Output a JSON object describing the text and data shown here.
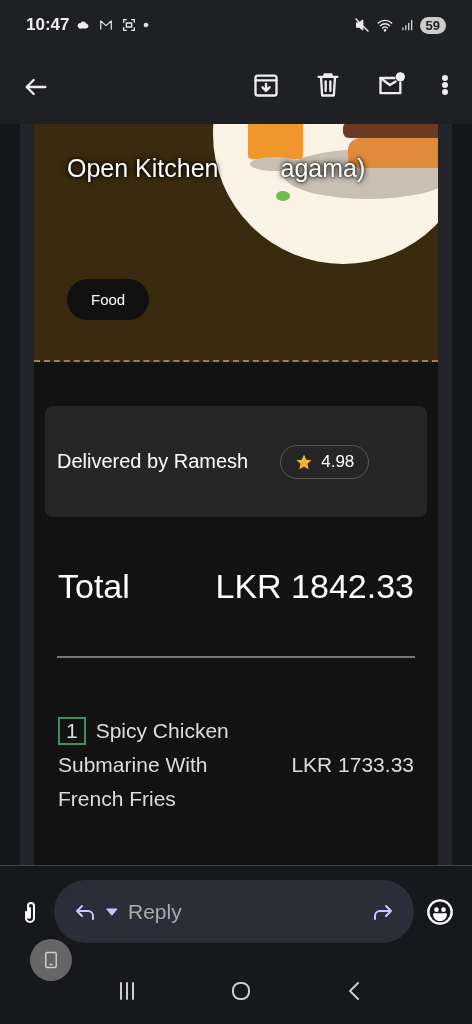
{
  "status_bar": {
    "time": "10:47",
    "battery": "59"
  },
  "header": {
    "title_parts": [
      "Open Kitchen",
      "agama)"
    ],
    "tag": "Food"
  },
  "delivery": {
    "text": "Delivered by Ramesh",
    "rating": "4.98"
  },
  "total": {
    "label": "Total",
    "amount": "LKR 1842.33"
  },
  "items": [
    {
      "quantity": "1",
      "name": "Spicy Chicken Submarine With French Fries",
      "price": "LKR 1733.33"
    }
  ],
  "reply_bar": {
    "placeholder": "Reply"
  }
}
